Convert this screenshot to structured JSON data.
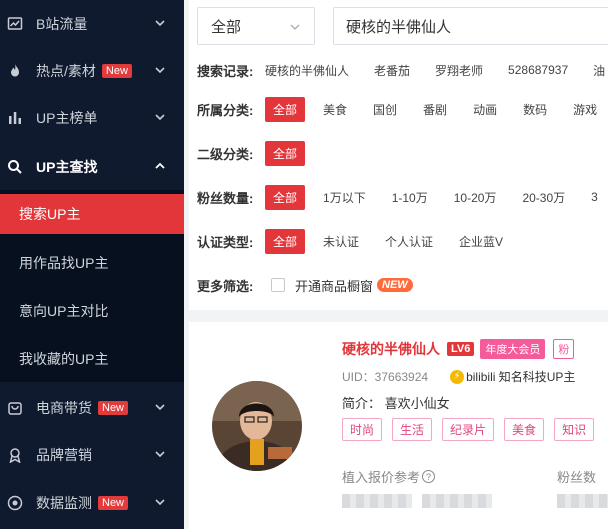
{
  "sidebar": {
    "items": [
      {
        "label": "B站流量",
        "icon": "trend-chart-icon",
        "badge": ""
      },
      {
        "label": "热点/素材",
        "icon": "flame-icon",
        "badge": "New"
      },
      {
        "label": "UP主榜单",
        "icon": "bar-chart-icon",
        "badge": ""
      },
      {
        "label": "UP主查找",
        "icon": "search-icon",
        "badge": ""
      },
      {
        "label": "电商带货",
        "icon": "shopping-bag-icon",
        "badge": "New"
      },
      {
        "label": "品牌营销",
        "icon": "award-icon",
        "badge": ""
      },
      {
        "label": "数据监测",
        "icon": "monitor-target-icon",
        "badge": "New"
      }
    ],
    "subitems": [
      {
        "label": "搜索UP主"
      },
      {
        "label": "用作品找UP主"
      },
      {
        "label": "意向UP主对比"
      },
      {
        "label": "我收藏的UP主"
      }
    ]
  },
  "search": {
    "scope": "全部",
    "query": "硬核的半佛仙人"
  },
  "filters": {
    "history_label": "搜索记录:",
    "history": [
      "硬核的半佛仙人",
      "老番茄",
      "罗翔老师",
      "528687937",
      "油"
    ],
    "category_label": "所属分类:",
    "categories": [
      "全部",
      "美食",
      "国创",
      "番剧",
      "动画",
      "数码",
      "游戏"
    ],
    "subcategory_label": "二级分类:",
    "subcategories": [
      "全部"
    ],
    "fans_label": "粉丝数量:",
    "fans": [
      "全部",
      "1万以下",
      "1-10万",
      "10-20万",
      "20-30万",
      "3"
    ],
    "verify_label": "认证类型:",
    "verify": [
      "全部",
      "未认证",
      "个人认证",
      "企业蓝V"
    ],
    "more_label": "更多筛选:",
    "shop_window": "开通商品橱窗",
    "new_tag": "NEW"
  },
  "result": {
    "name": "硬核的半佛仙人",
    "level": "LV6",
    "vip": "年度大会员",
    "fans_tag": "粉",
    "uid": "UID：37663924",
    "bili_verify": "bilibili 知名科技UP主",
    "intro": "简介：  喜欢小仙女",
    "tags": [
      "时尚",
      "生活",
      "纪录片",
      "美食",
      "知识"
    ],
    "price_label": "植入报价参考",
    "fans_label": "粉丝数"
  },
  "colors": {
    "sidebar_bg": "#0f1a2e",
    "accent_red": "#e2363b",
    "pink": "#f45b9a"
  }
}
